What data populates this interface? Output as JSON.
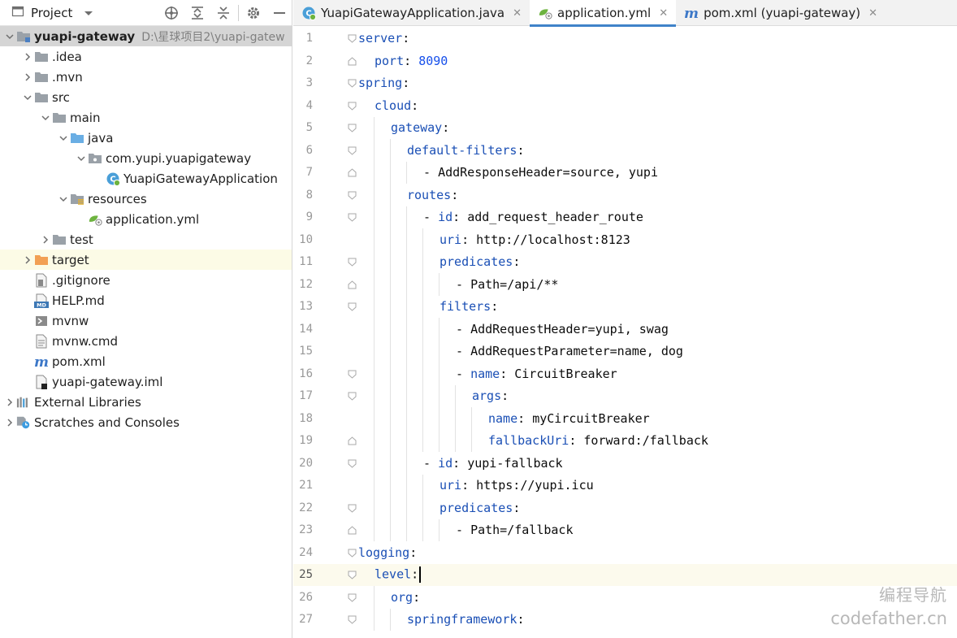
{
  "project_panel": {
    "title": "Project",
    "toolbar_icons": [
      "locate-icon",
      "expand-all-icon",
      "collapse-all-icon",
      "gear-icon",
      "hide-icon"
    ]
  },
  "tree": [
    {
      "label": "yuapi-gateway",
      "hint": "D:\\星球项目2\\yuapi-gatew",
      "depth": 0,
      "arrow": "open",
      "icon": "module-folder-icon",
      "bold": true,
      "selected": true
    },
    {
      "label": ".idea",
      "depth": 1,
      "arrow": "closed",
      "icon": "folder-icon"
    },
    {
      "label": ".mvn",
      "depth": 1,
      "arrow": "closed",
      "icon": "folder-icon"
    },
    {
      "label": "src",
      "depth": 1,
      "arrow": "open",
      "icon": "folder-icon"
    },
    {
      "label": "main",
      "depth": 2,
      "arrow": "open",
      "icon": "folder-icon"
    },
    {
      "label": "java",
      "depth": 3,
      "arrow": "open",
      "icon": "source-folder-icon"
    },
    {
      "label": "com.yupi.yuapigateway",
      "depth": 4,
      "arrow": "open",
      "icon": "package-icon"
    },
    {
      "label": "YuapiGatewayApplication",
      "depth": 5,
      "arrow": "none",
      "icon": "spring-boot-class-icon"
    },
    {
      "label": "resources",
      "depth": 3,
      "arrow": "open",
      "icon": "resources-folder-icon"
    },
    {
      "label": "application.yml",
      "depth": 4,
      "arrow": "none",
      "icon": "spring-yaml-icon"
    },
    {
      "label": "test",
      "depth": 2,
      "arrow": "closed",
      "icon": "folder-icon"
    },
    {
      "label": "target",
      "depth": 1,
      "arrow": "closed",
      "icon": "excluded-folder-icon",
      "highlight": true
    },
    {
      "label": ".gitignore",
      "depth": 1,
      "arrow": "none",
      "icon": "gitignore-file-icon"
    },
    {
      "label": "HELP.md",
      "depth": 1,
      "arrow": "none",
      "icon": "markdown-file-icon"
    },
    {
      "label": "mvnw",
      "depth": 1,
      "arrow": "none",
      "icon": "shell-file-icon"
    },
    {
      "label": "mvnw.cmd",
      "depth": 1,
      "arrow": "none",
      "icon": "text-file-icon"
    },
    {
      "label": "pom.xml",
      "depth": 1,
      "arrow": "none",
      "icon": "maven-icon"
    },
    {
      "label": "yuapi-gateway.iml",
      "depth": 1,
      "arrow": "none",
      "icon": "iml-file-icon"
    },
    {
      "label": "External Libraries",
      "depth": 0,
      "arrow": "closed",
      "icon": "libraries-icon"
    },
    {
      "label": "Scratches and Consoles",
      "depth": 0,
      "arrow": "closed",
      "icon": "scratches-icon"
    }
  ],
  "tabs": [
    {
      "label": "YuapiGatewayApplication.java",
      "icon": "spring-boot-class-icon",
      "active": false,
      "close": "✕"
    },
    {
      "label": "application.yml",
      "icon": "spring-yaml-icon",
      "active": true,
      "close": "✕"
    },
    {
      "label": "pom.xml (yuapi-gateway)",
      "icon": "maven-icon",
      "active": false,
      "close": "✕"
    }
  ],
  "editor": {
    "current_line": 25,
    "lines": [
      {
        "num": "1",
        "indent": 0,
        "key": "server",
        "sep": ":",
        "fold": "open"
      },
      {
        "num": "2",
        "indent": 1,
        "key": "port",
        "sep": ": ",
        "value": "8090",
        "value_type": "number",
        "fold": "end"
      },
      {
        "num": "3",
        "indent": 0,
        "key": "spring",
        "sep": ":",
        "fold": "open"
      },
      {
        "num": "4",
        "indent": 1,
        "key": "cloud",
        "sep": ":",
        "fold": "open"
      },
      {
        "num": "5",
        "indent": 2,
        "key": "gateway",
        "sep": ":",
        "fold": "open"
      },
      {
        "num": "6",
        "indent": 3,
        "key": "default-filters",
        "sep": ":",
        "fold": "open"
      },
      {
        "num": "7",
        "indent": 4,
        "dash": true,
        "value": "AddResponseHeader=source, yupi",
        "fold": "end"
      },
      {
        "num": "8",
        "indent": 3,
        "key": "routes",
        "sep": ":",
        "fold": "open"
      },
      {
        "num": "9",
        "indent": 4,
        "dash": true,
        "key": "id",
        "sep": ": ",
        "value": "add_request_header_route",
        "fold": "open"
      },
      {
        "num": "10",
        "indent": 5,
        "key": "uri",
        "sep": ": ",
        "value": "http://localhost:8123"
      },
      {
        "num": "11",
        "indent": 5,
        "key": "predicates",
        "sep": ":",
        "fold": "open"
      },
      {
        "num": "12",
        "indent": 6,
        "dash": true,
        "value": "Path=/api/**",
        "fold": "end"
      },
      {
        "num": "13",
        "indent": 5,
        "key": "filters",
        "sep": ":",
        "fold": "open"
      },
      {
        "num": "14",
        "indent": 6,
        "dash": true,
        "value": "AddRequestHeader=yupi, swag"
      },
      {
        "num": "15",
        "indent": 6,
        "dash": true,
        "value": "AddRequestParameter=name, dog"
      },
      {
        "num": "16",
        "indent": 6,
        "dash": true,
        "key": "name",
        "sep": ": ",
        "value": "CircuitBreaker",
        "fold": "open"
      },
      {
        "num": "17",
        "indent": 7,
        "key": "args",
        "sep": ":",
        "fold": "open"
      },
      {
        "num": "18",
        "indent": 8,
        "key": "name",
        "sep": ": ",
        "value": "myCircuitBreaker"
      },
      {
        "num": "19",
        "indent": 8,
        "key": "fallbackUri",
        "sep": ": ",
        "value": "forward:/fallback",
        "fold": "end"
      },
      {
        "num": "20",
        "indent": 4,
        "dash": true,
        "key": "id",
        "sep": ": ",
        "value": "yupi-fallback",
        "fold": "open"
      },
      {
        "num": "21",
        "indent": 5,
        "key": "uri",
        "sep": ": ",
        "value": "https://yupi.icu"
      },
      {
        "num": "22",
        "indent": 5,
        "key": "predicates",
        "sep": ":",
        "fold": "open"
      },
      {
        "num": "23",
        "indent": 6,
        "dash": true,
        "value": "Path=/fallback",
        "fold": "end"
      },
      {
        "num": "24",
        "indent": 0,
        "key": "logging",
        "sep": ":",
        "fold": "open"
      },
      {
        "num": "25",
        "indent": 1,
        "key": "level",
        "sep": ":",
        "fold": "open",
        "caret": true
      },
      {
        "num": "26",
        "indent": 2,
        "key": "org",
        "sep": ":",
        "fold": "open"
      },
      {
        "num": "27",
        "indent": 3,
        "key": "springframework",
        "sep": ":",
        "fold": "open"
      }
    ]
  },
  "watermark": {
    "line1": "编程导航",
    "line2": "codefather.cn"
  },
  "colors": {
    "key": "#1a4fb5",
    "number": "#1750eb",
    "tab_underline": "#4083c9",
    "selection": "#d5d5d5",
    "current_line": "#fcfaed"
  }
}
